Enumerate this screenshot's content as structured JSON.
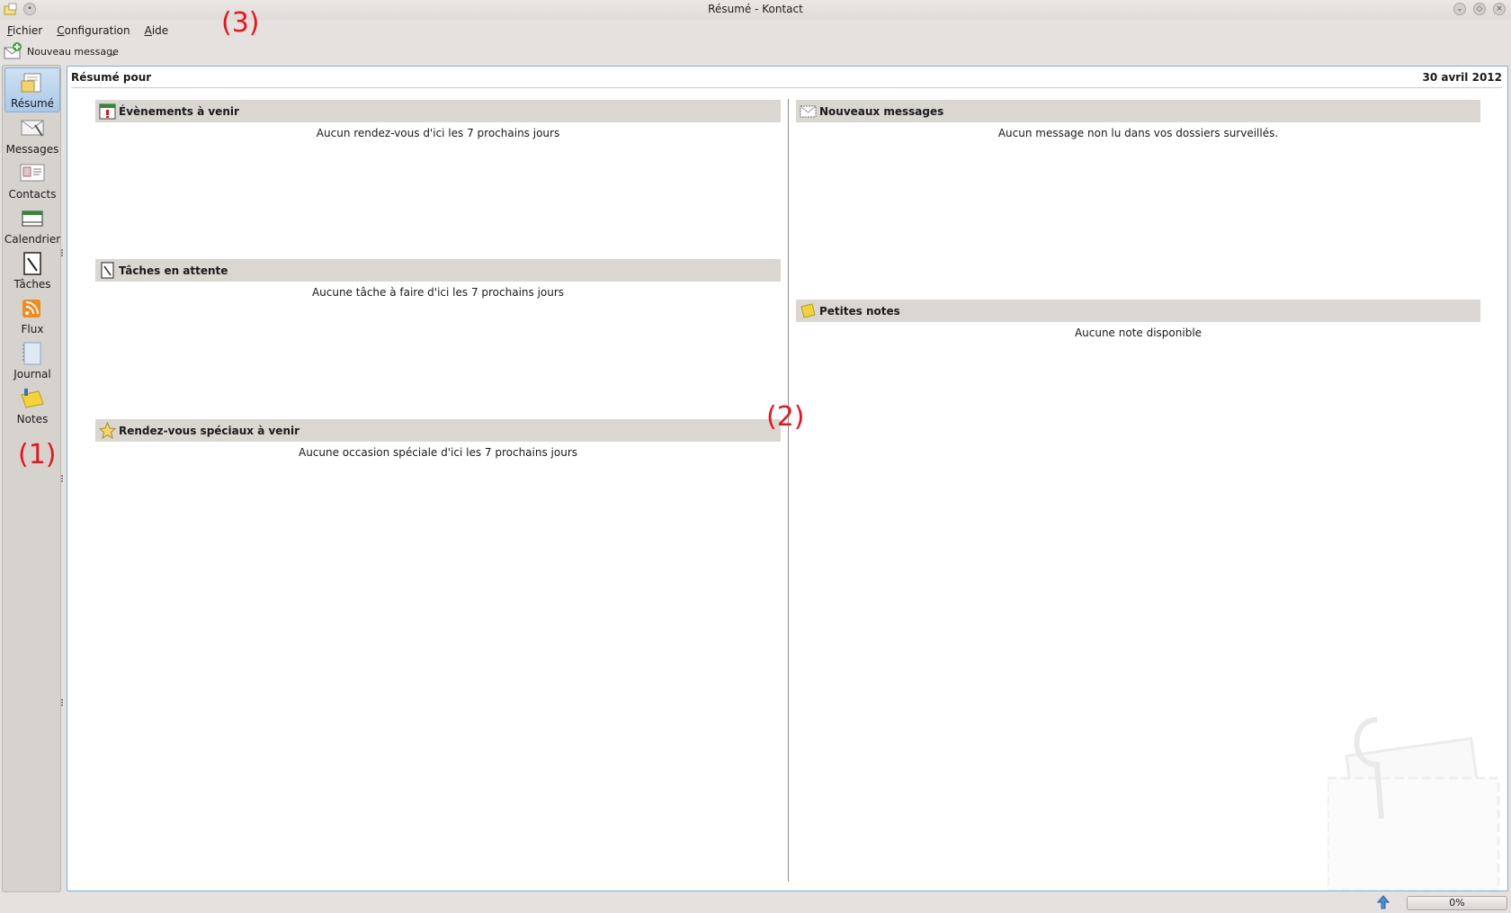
{
  "window": {
    "title": "Résumé - Kontact"
  },
  "menu": [
    "Fichier",
    "Configuration",
    "Aide"
  ],
  "toolbar": {
    "new_message": "Nouveau message"
  },
  "sidebar": {
    "items": [
      {
        "label": "Résumé"
      },
      {
        "label": "Messages"
      },
      {
        "label": "Contacts"
      },
      {
        "label": "Calendrier"
      },
      {
        "label": "Tâches"
      },
      {
        "label": "Flux"
      },
      {
        "label": "Journal"
      },
      {
        "label": "Notes"
      }
    ]
  },
  "summary": {
    "heading": "Résumé pour",
    "date": "30 avril 2012",
    "sections": {
      "events": {
        "title": "Évènements à venir",
        "message": "Aucun rendez-vous d'ici les 7 prochains jours"
      },
      "tasks": {
        "title": "Tâches en attente",
        "message": "Aucune tâche à faire d'ici les 7 prochains jours"
      },
      "special": {
        "title": "Rendez-vous spéciaux à venir",
        "message": "Aucune occasion spéciale d'ici les 7 prochains jours"
      },
      "new_messages": {
        "title": "Nouveaux messages",
        "message": "Aucun message non lu dans vos dossiers surveillés."
      },
      "notes": {
        "title": "Petites notes",
        "message": "Aucune note disponible"
      }
    }
  },
  "annotations": {
    "a1": "(1)",
    "a2": "(2)",
    "a3": "(3)"
  },
  "status": {
    "progress": "0%"
  }
}
